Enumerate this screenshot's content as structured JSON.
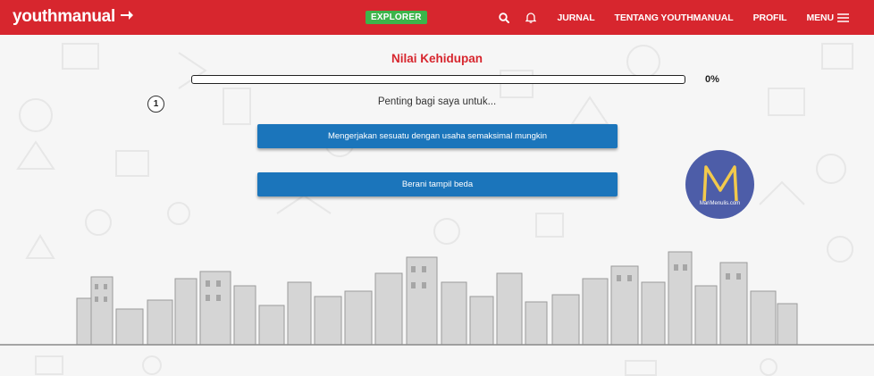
{
  "header": {
    "logo_text": "youthmanual",
    "badge": "EXPLORER",
    "nav": {
      "search_icon": "search-icon",
      "notification_icon": "bell-icon",
      "links": [
        "JURNAL",
        "TENTANG YOUTHMANUAL",
        "PROFIL"
      ],
      "menu_label": "MENU"
    },
    "colors": {
      "brand_red": "#d7262e",
      "badge_green": "#3cb44a"
    }
  },
  "quiz": {
    "title": "Nilai Kehidupan",
    "progress_fraction": 0,
    "progress_label": "0%",
    "question_number": "1",
    "prompt": "Penting bagi saya untuk...",
    "answers": [
      "Mengerjakan sesuatu dengan usaha semaksimal mungkin",
      "Berani tampil beda"
    ],
    "answer_color": "#1b75bb"
  },
  "watermark": {
    "letter": "M",
    "text": "MariMenulis.com"
  }
}
